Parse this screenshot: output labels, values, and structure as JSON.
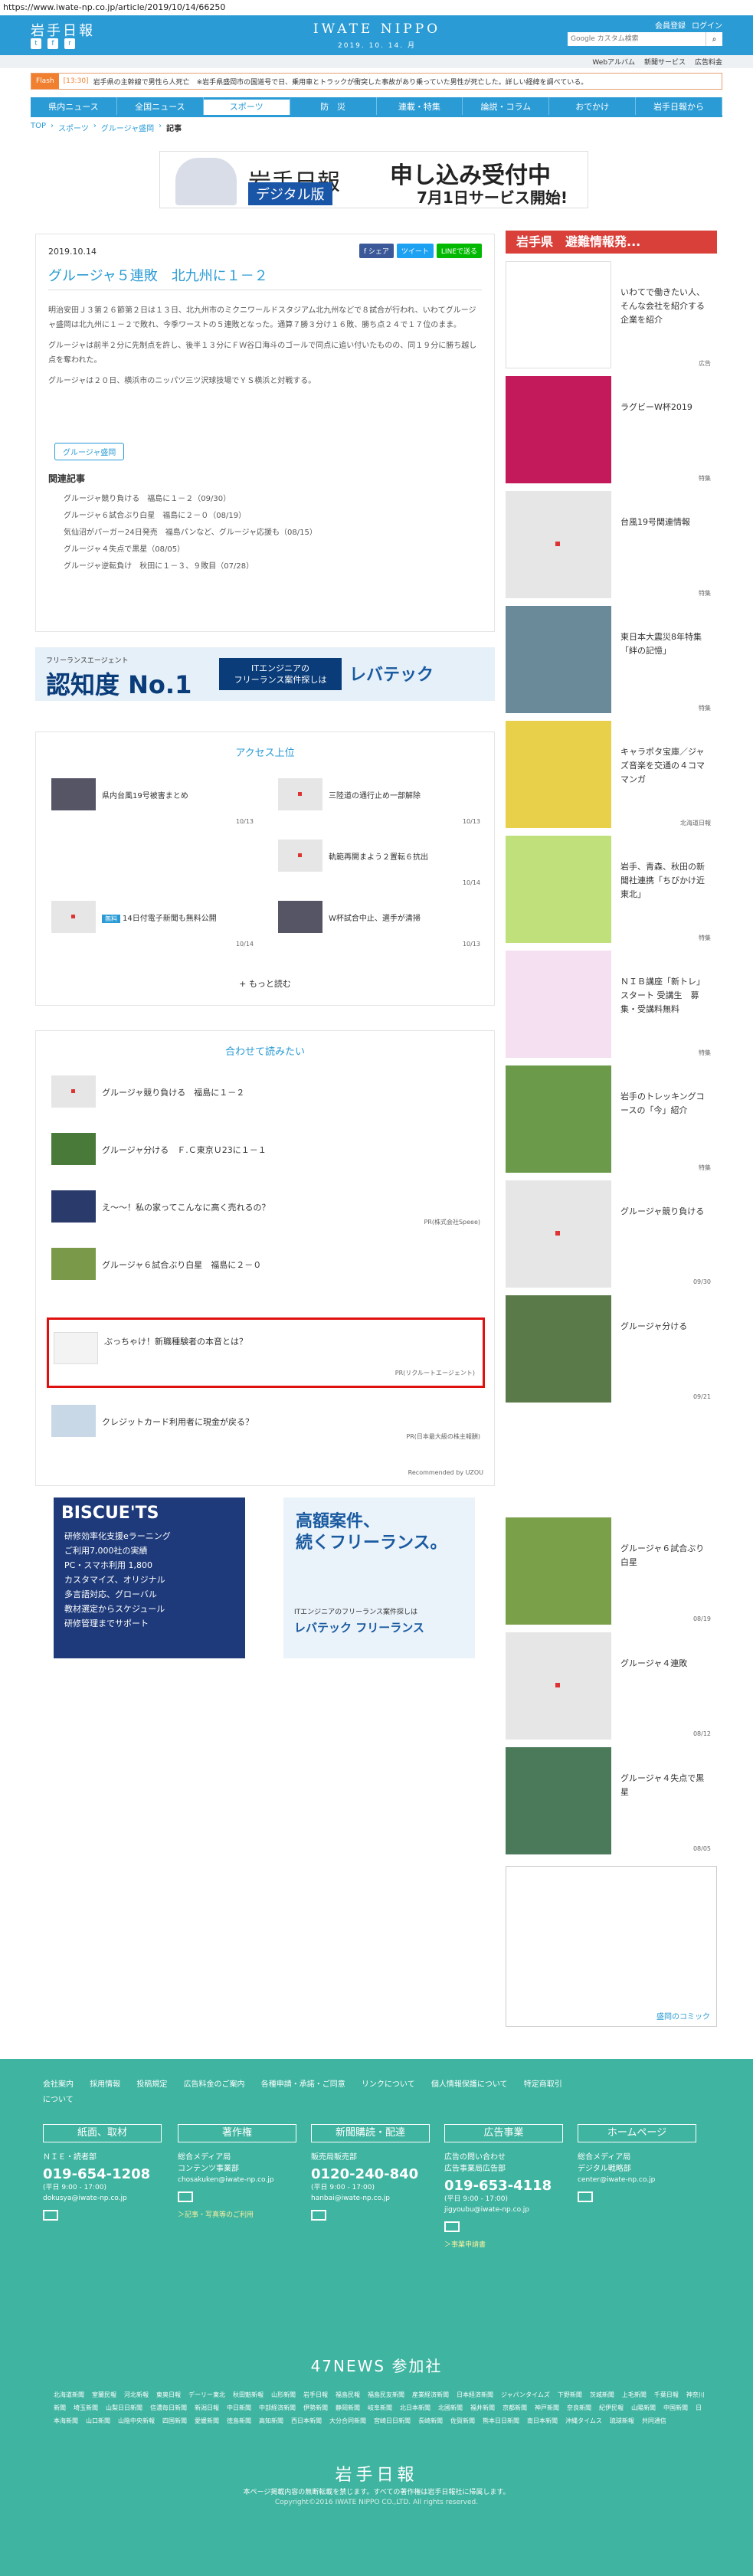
{
  "url": "https://www.iwate-np.co.jp/article/2019/10/14/66250",
  "header": {
    "logo_left": "岩手日報",
    "center_logo": "IWATE NIPPO",
    "date": "2019. 10. 14. 月",
    "register": "会員登録",
    "login": "ログイン",
    "search_placeholder": "Google カスタム検索",
    "search_icon": "search-icon"
  },
  "subbar": [
    "Webアルバム",
    "新聞サービス",
    "広告料金"
  ],
  "flash": {
    "tag": "Flash",
    "time": "[13:30]",
    "text": "岩手県の主幹線で男性ら人死亡　※岩手県盛岡市の国道号で日、乗用車とトラックが衝突した事故があり乗っていた男性が死亡した。詳しい経緯を調べている。"
  },
  "nav": [
    "県内ニュース",
    "全国ニュース",
    "スポーツ",
    "防　災",
    "連載・特集",
    "論説・コラム",
    "おでかけ",
    "岩手日報から"
  ],
  "nav_active": 2,
  "breadcrumb": [
    "TOP",
    "スポーツ",
    "グルージャ盛岡",
    "記事"
  ],
  "banner_top": {
    "logo": "岩手日報",
    "sub": "デジタル版",
    "l1": "申し込み受付中",
    "l2": "7月1日サービス開始!"
  },
  "article": {
    "date": "2019.10.14",
    "share": [
      "f シェア",
      "ツイート",
      "LINEで送る"
    ],
    "title": "グルージャ５連敗　北九州に１－２",
    "p1": "明治安田Ｊ３第２６節第２日は１３日、北九州市のミクニワールドスタジアム北九州などで８試合が行われ、いわてグルージャ盛岡は北九州に１－２で敗れ、今季ワーストの５連敗となった。通算７勝３分け１６敗、勝ち点２４で１７位のまま。",
    "p2": "グルージャは前半２分に先制点を許し、後半１３分にＦＷ谷口海斗のゴールで同点に追い付いたものの、同１９分に勝ち越し点を奪われた。",
    "p3": "グルージャは２０日、横浜市のニッパツ三ツ沢球技場でＹＳ横浜と対戦する。",
    "tag": "グルージャ盛岡",
    "related_heading": "関連記事",
    "related": [
      "グルージャ競り負ける　福島に１－２（09/30）",
      "グルージャ６試合ぶり白星　福島に２－０（08/19）",
      "気仙沼がパーガー24日発売　福島パンなど、グルージャ応援も（08/15）",
      "グルージャ４失点で黒星（08/05）",
      "グルージャ逆転負け　秋田に１－３、９敗目（07/28）"
    ]
  },
  "ad_mid": {
    "a1": "フリーランスエージェント",
    "a2": "認知度 No.1",
    "a3": "ITエンジニアの\nフリーランス案件探しは",
    "a4": "レバテック"
  },
  "access": {
    "heading": "アクセス上位",
    "items": [
      {
        "title": "県内台風19号被害まとめ",
        "date": "10/13",
        "img": true
      },
      {
        "title": "三陸道の通行止め一部解除",
        "date": "10/13",
        "img": false
      },
      {
        "title": "軌範再開まよう２置転６抗出",
        "date": "10/14",
        "img": false
      },
      {
        "title": "14日付電子新聞も無料公開",
        "date": "10/14",
        "img": false,
        "badge": "無料"
      },
      {
        "title": "W杯試合中止、選手が清掃",
        "date": "10/13",
        "img": true
      }
    ],
    "more": "+ もっと読む"
  },
  "reco": {
    "heading": "合わせて読みたい",
    "items": [
      {
        "title": "グルージャ競り負ける　福島に１－２",
        "pr": ""
      },
      {
        "title": "グルージャ分ける　Ｆ.Ｃ東京Ｕ23に１－１",
        "pr": ""
      },
      {
        "title": "え〜〜！私の家ってこんなに高く売れるの？",
        "pr": "PR(株式会社Speee)"
      },
      {
        "title": "グルージャ６試合ぶり白星　福島に２－０",
        "pr": ""
      },
      {
        "title": "ぶっちゃけ！新職種験者の本音とは？",
        "pr": "PR(リクルートエージェント)"
      },
      {
        "title": "クレジットカード利用者に現金が戻る？",
        "pr": "PR(日本最大級の株主報酬)"
      }
    ],
    "foot": "Recommended by UZOU"
  },
  "ads_bottom": {
    "b1t": "BISCUE'TS",
    "b1": "研修効率化支援eラーニング\nご利用7,000社の実績\nPC・スマホ利用 1,800\nカスタマイズ、オリジナル\n多言語対応、グローバル\n教材選定からスケジュール\n研修管理までサポート",
    "b2a": "高額案件、\n続くフリーランス。",
    "b2b": "ITエンジニアのフリーランス案件探しは",
    "b2c": "レバテック フリーランス"
  },
  "sidebar": {
    "heading": "岩手県　避難情報発...",
    "items": [
      {
        "title": "いわてで働きたい人、そんな会社を紹介する企業を紹介",
        "date": "広告"
      },
      {
        "title": "ラグビーW杯2019",
        "date": "特集"
      },
      {
        "title": "台風19号関連情報",
        "date": "特集"
      },
      {
        "title": "東日本大震災8年特集「絆の記憶」",
        "date": "特集"
      },
      {
        "title": "キャラポタ宝庫／ジャズ音楽を交通の４コママンガ",
        "date": "北海道日報"
      },
      {
        "title": "岩手、青森、秋田の新聞社連携「ちびかけ近東北」",
        "date": "特集"
      },
      {
        "title": "ＮＩＢ講座「新トレ」スタート 受講生　募集・受講料無料",
        "date": "特集"
      },
      {
        "title": "岩手のトレッキングコースの「今」紹介",
        "date": "特集"
      },
      {
        "title": "グルージャ競り負ける",
        "date": "09/30"
      },
      {
        "title": "グルージャ分ける",
        "date": "09/21"
      },
      {
        "title": "グルージャ６試合ぶり白星",
        "date": "08/19"
      },
      {
        "title": "グルージャ４連敗",
        "date": "08/12"
      },
      {
        "title": "グルージャ４失点で黒星",
        "date": "08/05"
      }
    ],
    "comic": "盛岡のコミック"
  },
  "footer": {
    "links": [
      "会社案内",
      "採用情報",
      "投稿規定",
      "広告料金のご案内",
      "各種申請・承諾・ご同意",
      "リンクについて",
      "個人情報保護について",
      "特定商取引について"
    ],
    "cols": [
      {
        "h": "紙面、取材",
        "s": "ＮＩＥ・読者部",
        "tel": "019-654-1208",
        "hours": "(平日 9:00 - 17:00)",
        "mail": "dokusya@iwate-np.co.jp",
        "link": ""
      },
      {
        "h": "著作権",
        "s": "総合メディア局\nコンテンツ事業部",
        "tel": "",
        "hours": "",
        "mail": "chosakuken@iwate-np.co.jp",
        "link": "＞記事・写真等のご利用"
      },
      {
        "h": "新聞購読・配達",
        "s": "販売局販売部",
        "tel": "0120-240-840",
        "hours": "(平日 9:00 - 17:00)",
        "mail": "hanbai@iwate-np.co.jp",
        "link": ""
      },
      {
        "h": "広告事業",
        "s": "広告の問い合わせ\n広告事業局広告部",
        "tel": "019-653-4118",
        "hours": "(平日 9:00 - 17:00)",
        "mail": "jigyoubu@iwate-np.co.jp",
        "link": "＞事業申請書"
      },
      {
        "h": "ホームページ",
        "s": "総合メディア局\nデジタル戦略部",
        "tel": "",
        "hours": "",
        "mail": "center@iwate-np.co.jp",
        "link": ""
      }
    ],
    "news_heading": "47NEWS 参加社",
    "news_list": [
      "北海道新聞",
      "室蘭民報",
      "河北新報",
      "東奥日報",
      "デーリー東北",
      "秋田魁新報",
      "山形新聞",
      "岩手日報",
      "福島民報",
      "福島民友新聞",
      "産業経済新聞",
      "日本経済新聞",
      "ジャパンタイムズ",
      "下野新聞",
      "茨城新聞",
      "上毛新聞",
      "千葉日報",
      "神奈川新聞",
      "埼玉新聞",
      "山梨日日新聞",
      "信濃毎日新聞",
      "新潟日報",
      "中日新聞",
      "中部経済新聞",
      "伊勢新聞",
      "静岡新聞",
      "岐阜新聞",
      "北日本新聞",
      "北國新聞",
      "福井新聞",
      "京都新聞",
      "神戸新聞",
      "奈良新聞",
      "紀伊民報",
      "山陽新聞",
      "中国新聞",
      "日本海新聞",
      "山口新聞",
      "山陰中央新報",
      "四国新聞",
      "愛媛新聞",
      "徳島新聞",
      "高知新聞",
      "西日本新聞",
      "大分合同新聞",
      "宮崎日日新聞",
      "長崎新聞",
      "佐賀新聞",
      "熊本日日新聞",
      "南日本新聞",
      "沖縄タイムス",
      "琉球新報",
      "共同通信"
    ],
    "logo": "岩手日報",
    "note": "本ページ掲載内容の無断転載を禁じます。すべての著作権は岩手日報社に帰属します。",
    "copy": "Copyright©2016 IWATE NIPPO CO.,LTD. All rights reserved."
  },
  "colors": {
    "brand": "#2a9bd5",
    "footer": "#3fb4a0",
    "accent": "#d9403a",
    "highlight": "#e01010"
  }
}
